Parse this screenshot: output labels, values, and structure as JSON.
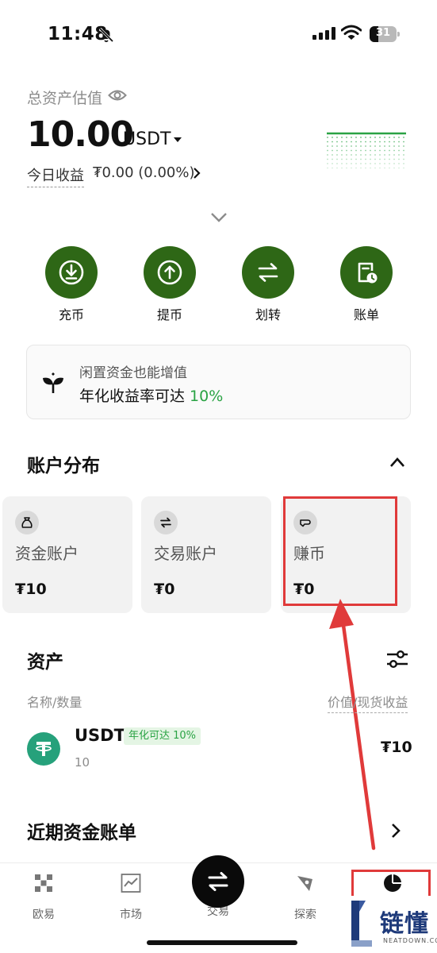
{
  "status_bar": {
    "time": "11:48",
    "battery": "31",
    "battery_level": 0.31
  },
  "header": {
    "total_label": "总资产估值",
    "balance": "10.00",
    "unit": "USDT",
    "pnl_label": "今日收益",
    "pnl_value": "₮0.00 (0.00%)"
  },
  "actions": [
    {
      "label": "充币",
      "icon": "deposit-icon"
    },
    {
      "label": "提币",
      "icon": "withdraw-icon"
    },
    {
      "label": "划转",
      "icon": "transfer-icon"
    },
    {
      "label": "账单",
      "icon": "bill-icon"
    }
  ],
  "promo": {
    "line1": "闲置资金也能增值",
    "line2_prefix": "年化收益率可达 ",
    "rate": "10%",
    "icon": "sprout-icon"
  },
  "distribution": {
    "title": "账户分布",
    "cards": [
      {
        "name": "资金账户",
        "value": "₮10",
        "icon": "money-bag-icon"
      },
      {
        "name": "交易账户",
        "value": "₮0",
        "icon": "swap-icon"
      },
      {
        "name": "赚币",
        "value": "₮0",
        "icon": "earn-icon"
      }
    ]
  },
  "assets": {
    "title": "资产",
    "col_left": "名称/数量",
    "col_right": "价值/现货收益",
    "rows": [
      {
        "symbol": "USDT",
        "badge": "年化可达 10%",
        "qty": "10",
        "value": "₮10"
      }
    ]
  },
  "recent": {
    "title": "近期资金账单"
  },
  "nav": {
    "items": [
      {
        "label": "欧易",
        "icon": "okx-logo-icon"
      },
      {
        "label": "市场",
        "icon": "market-chart-icon"
      },
      {
        "label": "交易",
        "icon": "trade-swap-icon"
      },
      {
        "label": "探索",
        "icon": "compass-icon"
      },
      {
        "label": "",
        "icon": "assets-pie-icon"
      }
    ]
  },
  "colors": {
    "accent_green": "#2e6716",
    "rate_green": "#2aa344",
    "highlight_red": "#e03a3a",
    "tether": "#26a17b"
  },
  "watermark": {
    "text": "链懂",
    "sub": "NEATDOWN.COM"
  }
}
